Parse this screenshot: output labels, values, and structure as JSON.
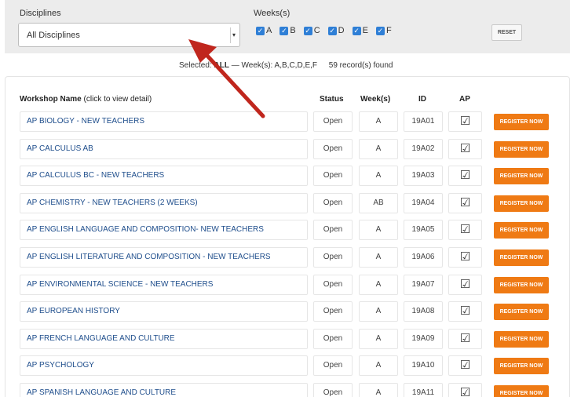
{
  "filters": {
    "disciplines_label": "Disciplines",
    "disciplines_value": "All Disciplines",
    "weeks_label": "Weeks(s)",
    "weeks": [
      {
        "label": "A",
        "checked": true
      },
      {
        "label": "B",
        "checked": true
      },
      {
        "label": "C",
        "checked": true
      },
      {
        "label": "D",
        "checked": true
      },
      {
        "label": "E",
        "checked": true
      },
      {
        "label": "F",
        "checked": true
      }
    ],
    "reset_label": "RESET"
  },
  "summary": {
    "prefix": "Selected:",
    "selected": "ALL",
    "weeks_text": "— Week(s): A,B,C,D,E,F",
    "count_text": "59 record(s) found"
  },
  "table": {
    "headers": {
      "name": "Workshop Name",
      "name_hint": "(click to view detail)",
      "status": "Status",
      "weeks": "Week(s)",
      "id": "ID",
      "ap": "AP"
    },
    "register_label": "REGISTER NOW",
    "rows": [
      {
        "name": "AP BIOLOGY - NEW TEACHERS",
        "status": "Open",
        "weeks": "A",
        "id": "19A01",
        "ap": "☑"
      },
      {
        "name": "AP CALCULUS AB",
        "status": "Open",
        "weeks": "A",
        "id": "19A02",
        "ap": "☑"
      },
      {
        "name": "AP CALCULUS BC - NEW TEACHERS",
        "status": "Open",
        "weeks": "A",
        "id": "19A03",
        "ap": "☑"
      },
      {
        "name": "AP CHEMISTRY - NEW TEACHERS (2 WEEKS)",
        "status": "Open",
        "weeks": "AB",
        "id": "19A04",
        "ap": "☑"
      },
      {
        "name": "AP ENGLISH LANGUAGE AND COMPOSITION- NEW TEACHERS",
        "status": "Open",
        "weeks": "A",
        "id": "19A05",
        "ap": "☑"
      },
      {
        "name": "AP ENGLISH LITERATURE AND COMPOSITION - NEW TEACHERS",
        "status": "Open",
        "weeks": "A",
        "id": "19A06",
        "ap": "☑"
      },
      {
        "name": "AP ENVIRONMENTAL SCIENCE - NEW TEACHERS",
        "status": "Open",
        "weeks": "A",
        "id": "19A07",
        "ap": "☑"
      },
      {
        "name": "AP EUROPEAN HISTORY",
        "status": "Open",
        "weeks": "A",
        "id": "19A08",
        "ap": "☑"
      },
      {
        "name": "AP FRENCH LANGUAGE AND CULTURE",
        "status": "Open",
        "weeks": "A",
        "id": "19A09",
        "ap": "☑"
      },
      {
        "name": "AP PSYCHOLOGY",
        "status": "Open",
        "weeks": "A",
        "id": "19A10",
        "ap": "☑"
      },
      {
        "name": "AP SPANISH LANGUAGE AND CULTURE",
        "status": "Open",
        "weeks": "A",
        "id": "19A11",
        "ap": "☑"
      }
    ]
  },
  "colors": {
    "accent_orange": "#ef7a14",
    "link_blue": "#1f4e8c",
    "checkbox_blue": "#2f7fd6",
    "annotation_arrow": "#c0261d"
  }
}
